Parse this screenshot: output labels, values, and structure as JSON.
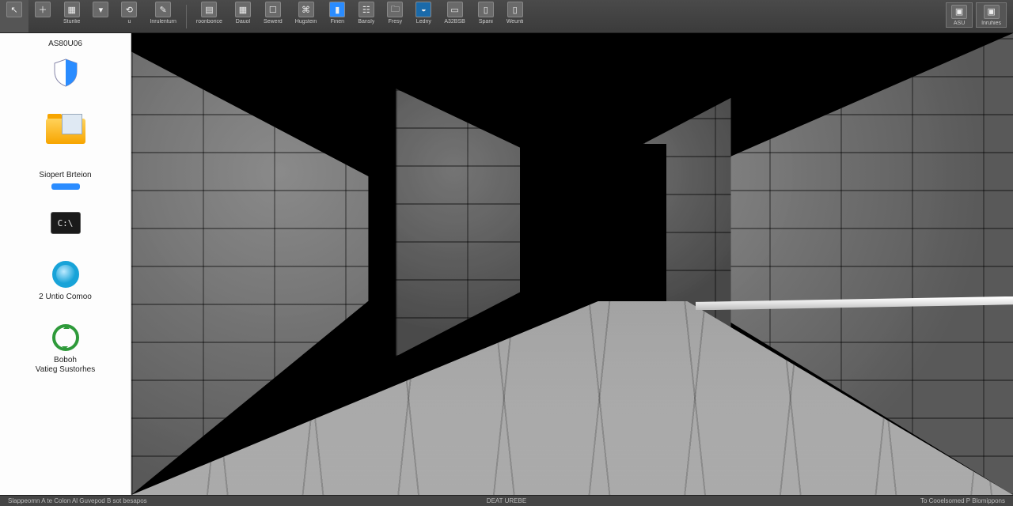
{
  "toolbar": {
    "left": [
      {
        "icon": "cursor-icon",
        "label": ""
      },
      {
        "icon": "plus-icon",
        "label": ""
      },
      {
        "icon": "save-icon",
        "label": "Sturilie"
      },
      {
        "icon": "chevron-down-icon",
        "label": ""
      },
      {
        "icon": "rotate-icon",
        "label": "u"
      },
      {
        "icon": "tool-icon",
        "label": "Inrulenturn"
      }
    ],
    "center": [
      {
        "icon": "panel-icon",
        "label": "roonborice"
      },
      {
        "icon": "grid-icon",
        "label": "Dauol"
      },
      {
        "icon": "window-icon",
        "label": "Sewerd"
      },
      {
        "icon": "script-icon",
        "label": "Hugstein"
      },
      {
        "icon": "file-icon",
        "label": "Finen"
      },
      {
        "icon": "network-icon",
        "label": "Bansly"
      },
      {
        "icon": "folder-icon",
        "label": "Fresy"
      },
      {
        "icon": "flame-icon",
        "label": "Ledny"
      },
      {
        "icon": "display-icon",
        "label": "A32BSB"
      },
      {
        "icon": "page-icon",
        "label": "Spani"
      },
      {
        "icon": "page2-icon",
        "label": "Weunti"
      }
    ],
    "right": [
      {
        "icon": "a-icon",
        "label": "ASU"
      },
      {
        "icon": "b-icon",
        "label": "Inruhies"
      }
    ]
  },
  "sidebar": {
    "items": [
      {
        "kind": "shield",
        "label": "AS80U06"
      },
      {
        "kind": "folder",
        "label": ""
      },
      {
        "kind": "pill",
        "label": "Siopert Brteion"
      },
      {
        "kind": "cmd",
        "label": ""
      },
      {
        "kind": "ring",
        "label": "2 Untio Comoo"
      },
      {
        "kind": "recycle",
        "label": "Boboh\nVatieg Sustorhes"
      }
    ]
  },
  "status": {
    "left": "Slappeomn A te Colon Al Guvepod B sot besapos",
    "center": "DEAT UREBE",
    "right": "To Cooelsomed P Blomippons"
  }
}
